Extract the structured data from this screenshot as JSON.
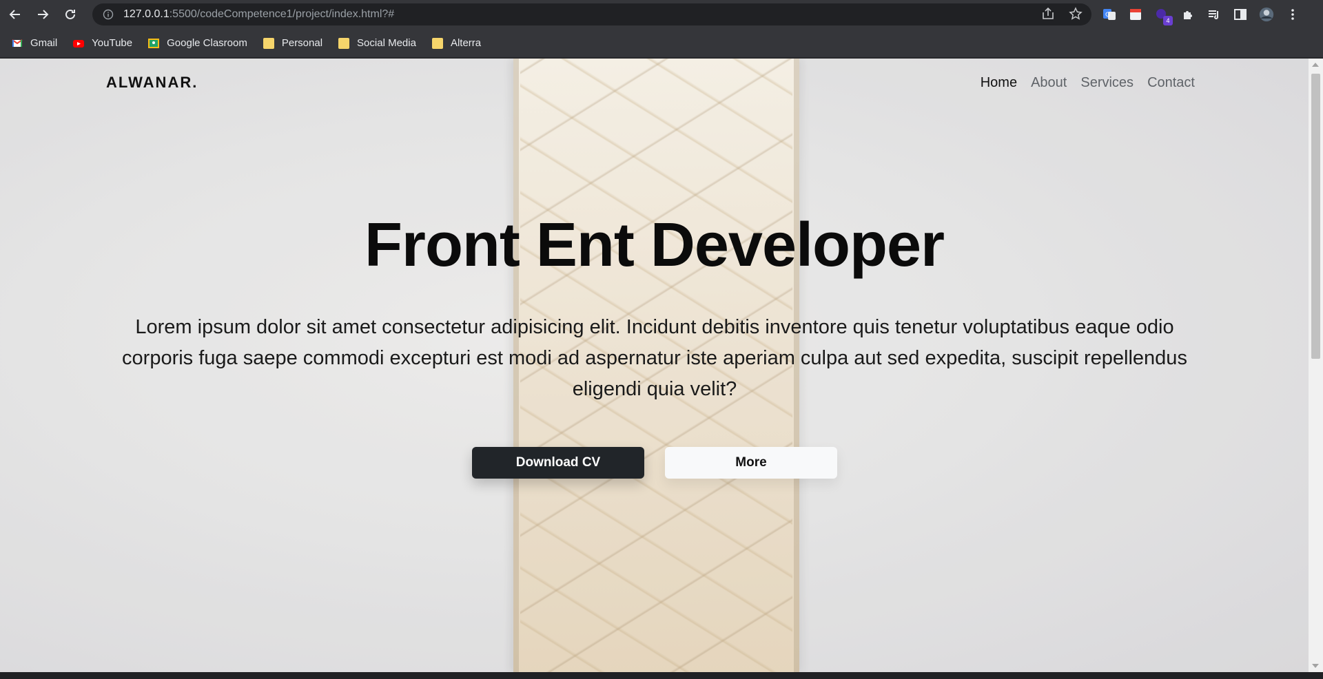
{
  "browser": {
    "url_host": "127.0.0.1",
    "url_rest": ":5500/codeCompetence1/project/index.html?#",
    "nav_icons": [
      "back-arrow-icon",
      "forward-arrow-icon",
      "reload-icon"
    ],
    "extension_badge": "4"
  },
  "bookmarks": [
    {
      "label": "Gmail",
      "icon": "gmail-icon"
    },
    {
      "label": "YouTube",
      "icon": "youtube-icon"
    },
    {
      "label": "Google Clasroom",
      "icon": "classroom-icon"
    },
    {
      "label": "Personal",
      "icon": "folder-icon"
    },
    {
      "label": "Social Media",
      "icon": "folder-icon"
    },
    {
      "label": "Alterra",
      "icon": "folder-icon"
    }
  ],
  "site": {
    "brand": "ALWANAR.",
    "menu": [
      "Home",
      "About",
      "Services",
      "Contact"
    ],
    "active_menu": "Home",
    "hero_title": "Front Ent Developer",
    "hero_text": "Lorem ipsum dolor sit amet consectetur adipisicing elit. Incidunt debitis inventore quis tenetur voluptatibus eaque odio corporis fuga saepe commodi excepturi est modi ad aspernatur iste aperiam culpa aut sed expedita, suscipit repellendus eligendi quia velit?",
    "primary_button": "Download CV",
    "secondary_button": "More"
  },
  "colors": {
    "chrome_bg": "#35363a",
    "button_dark": "#212529",
    "button_light": "#f8f9fa"
  }
}
